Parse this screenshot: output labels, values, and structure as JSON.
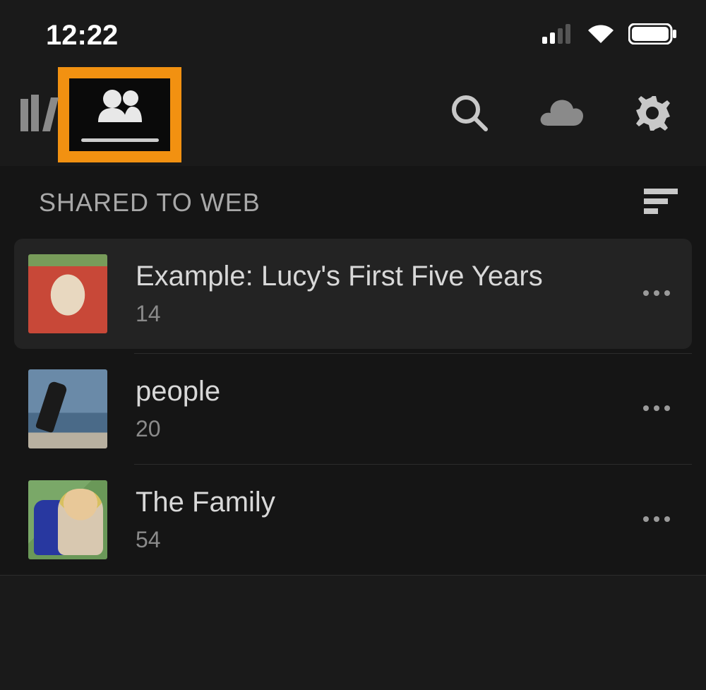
{
  "status": {
    "time": "12:22"
  },
  "section": {
    "title": "SHARED TO WEB"
  },
  "items": [
    {
      "title": "Example: Lucy's First Five Years",
      "count": "14"
    },
    {
      "title": "people",
      "count": "20"
    },
    {
      "title": "The Family",
      "count": "54"
    }
  ]
}
